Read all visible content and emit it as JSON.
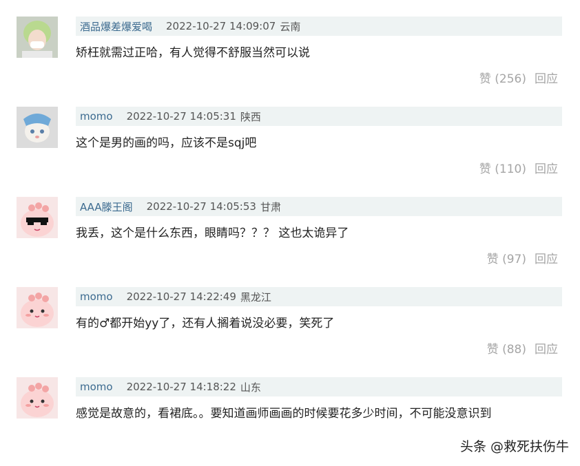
{
  "comments": [
    {
      "username": "酒品爆差爆爱喝",
      "time": "2022-10-27 14:09:07",
      "location": "云南",
      "text": "矫枉就需过正哈，有人觉得不舒服当然可以说",
      "like_label": "赞 (256)",
      "reply_label": "回应",
      "avatar_icon": "girl-avatar-icon"
    },
    {
      "username": "momo",
      "time": "2022-10-27 14:05:31",
      "location": "陕西",
      "text": "这个是男的画的吗，应该不是sqj吧",
      "like_label": "赞 (110)",
      "reply_label": "回应",
      "avatar_icon": "cat-avatar-icon"
    },
    {
      "username": "AAA滕王阁",
      "time": "2022-10-27 14:05:53",
      "location": "甘肃",
      "text": "我丢，这个是什么东西，眼睛吗？？？ 这也太诡异了",
      "like_label": "赞 (97)",
      "reply_label": "回应",
      "avatar_icon": "pink-blob-sunglasses-avatar-icon"
    },
    {
      "username": "momo",
      "time": "2022-10-27 14:22:49",
      "location": "黑龙江",
      "text": "有的♂都开始yy了，还有人搁着说没必要，笑死了",
      "like_label": "赞 (88)",
      "reply_label": "回应",
      "avatar_icon": "pink-blob-avatar-icon"
    },
    {
      "username": "momo",
      "time": "2022-10-27 14:18:22",
      "location": "山东",
      "text": "感觉是故意的，看裙底。。要知道画师画画的时候要花多少时间，不可能没意识到",
      "like_label": "",
      "reply_label": "",
      "avatar_icon": "pink-blob-avatar-icon"
    }
  ],
  "watermark": "头条 @救死扶伤牛"
}
